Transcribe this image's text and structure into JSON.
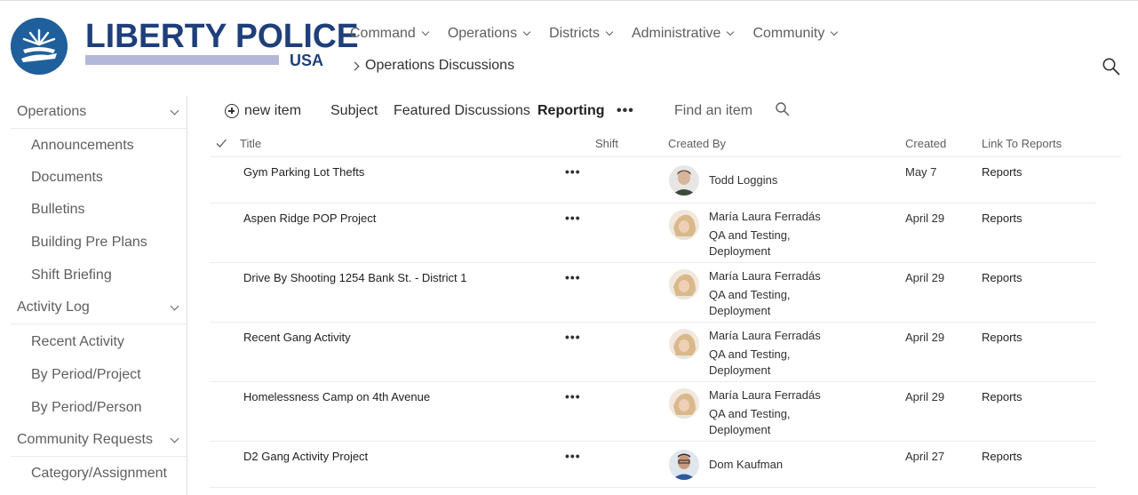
{
  "brand": {
    "name": "LIBERTY POLICE",
    "sub": "USA"
  },
  "topnav": [
    {
      "label": "Command"
    },
    {
      "label": "Operations"
    },
    {
      "label": "Districts"
    },
    {
      "label": "Administrative"
    },
    {
      "label": "Community"
    }
  ],
  "breadcrumb": {
    "label": "Operations Discussions"
  },
  "leftnav": {
    "groups": [
      {
        "label": "Operations",
        "items": [
          "Announcements",
          "Documents",
          "Bulletins",
          "Building Pre Plans",
          "Shift Briefing"
        ]
      },
      {
        "label": "Activity Log",
        "items": [
          "Recent Activity",
          "By Period/Project",
          "By Period/Person"
        ]
      },
      {
        "label": "Community Requests",
        "items": [
          "Category/Assignment"
        ]
      }
    ]
  },
  "commandbar": {
    "new_item": "new item",
    "views": [
      "Subject",
      "Featured Discussions",
      "Reporting"
    ],
    "active_view": "Reporting",
    "more": "•••",
    "find_placeholder": "Find an item"
  },
  "columns": {
    "title": "Title",
    "shift": "Shift",
    "created_by": "Created By",
    "created": "Created",
    "link": "Link To Reports"
  },
  "rows": [
    {
      "title": "Gym Parking Lot Thefts",
      "author": "Todd Loggins",
      "author_detail": "",
      "created": "May 7",
      "link": "Reports",
      "avatar": "todd"
    },
    {
      "title": "Aspen Ridge POP Project",
      "author": "María Laura Ferradás",
      "author_detail": "QA and Testing, Deployment",
      "created": "April 29",
      "link": "Reports",
      "avatar": "maria"
    },
    {
      "title": "Drive By Shooting 1254 Bank St. - District 1",
      "author": "María Laura Ferradás",
      "author_detail": "QA and Testing, Deployment",
      "created": "April 29",
      "link": "Reports",
      "avatar": "maria"
    },
    {
      "title": "Recent Gang Activity",
      "author": "María Laura Ferradás",
      "author_detail": "QA and Testing, Deployment",
      "created": "April 29",
      "link": "Reports",
      "avatar": "maria"
    },
    {
      "title": "Homelessness Camp on 4th Avenue",
      "author": "María Laura Ferradás",
      "author_detail": "QA and Testing, Deployment",
      "created": "April 29",
      "link": "Reports",
      "avatar": "maria"
    },
    {
      "title": "D2 Gang Activity Project",
      "author": "Dom Kaufman",
      "author_detail": "",
      "created": "April 27",
      "link": "Reports",
      "avatar": "dom"
    }
  ],
  "colors": {
    "brand_blue": "#1f3f7a",
    "badge_blue": "#1f5f9c",
    "brand_bar": "#b4b8d8"
  }
}
